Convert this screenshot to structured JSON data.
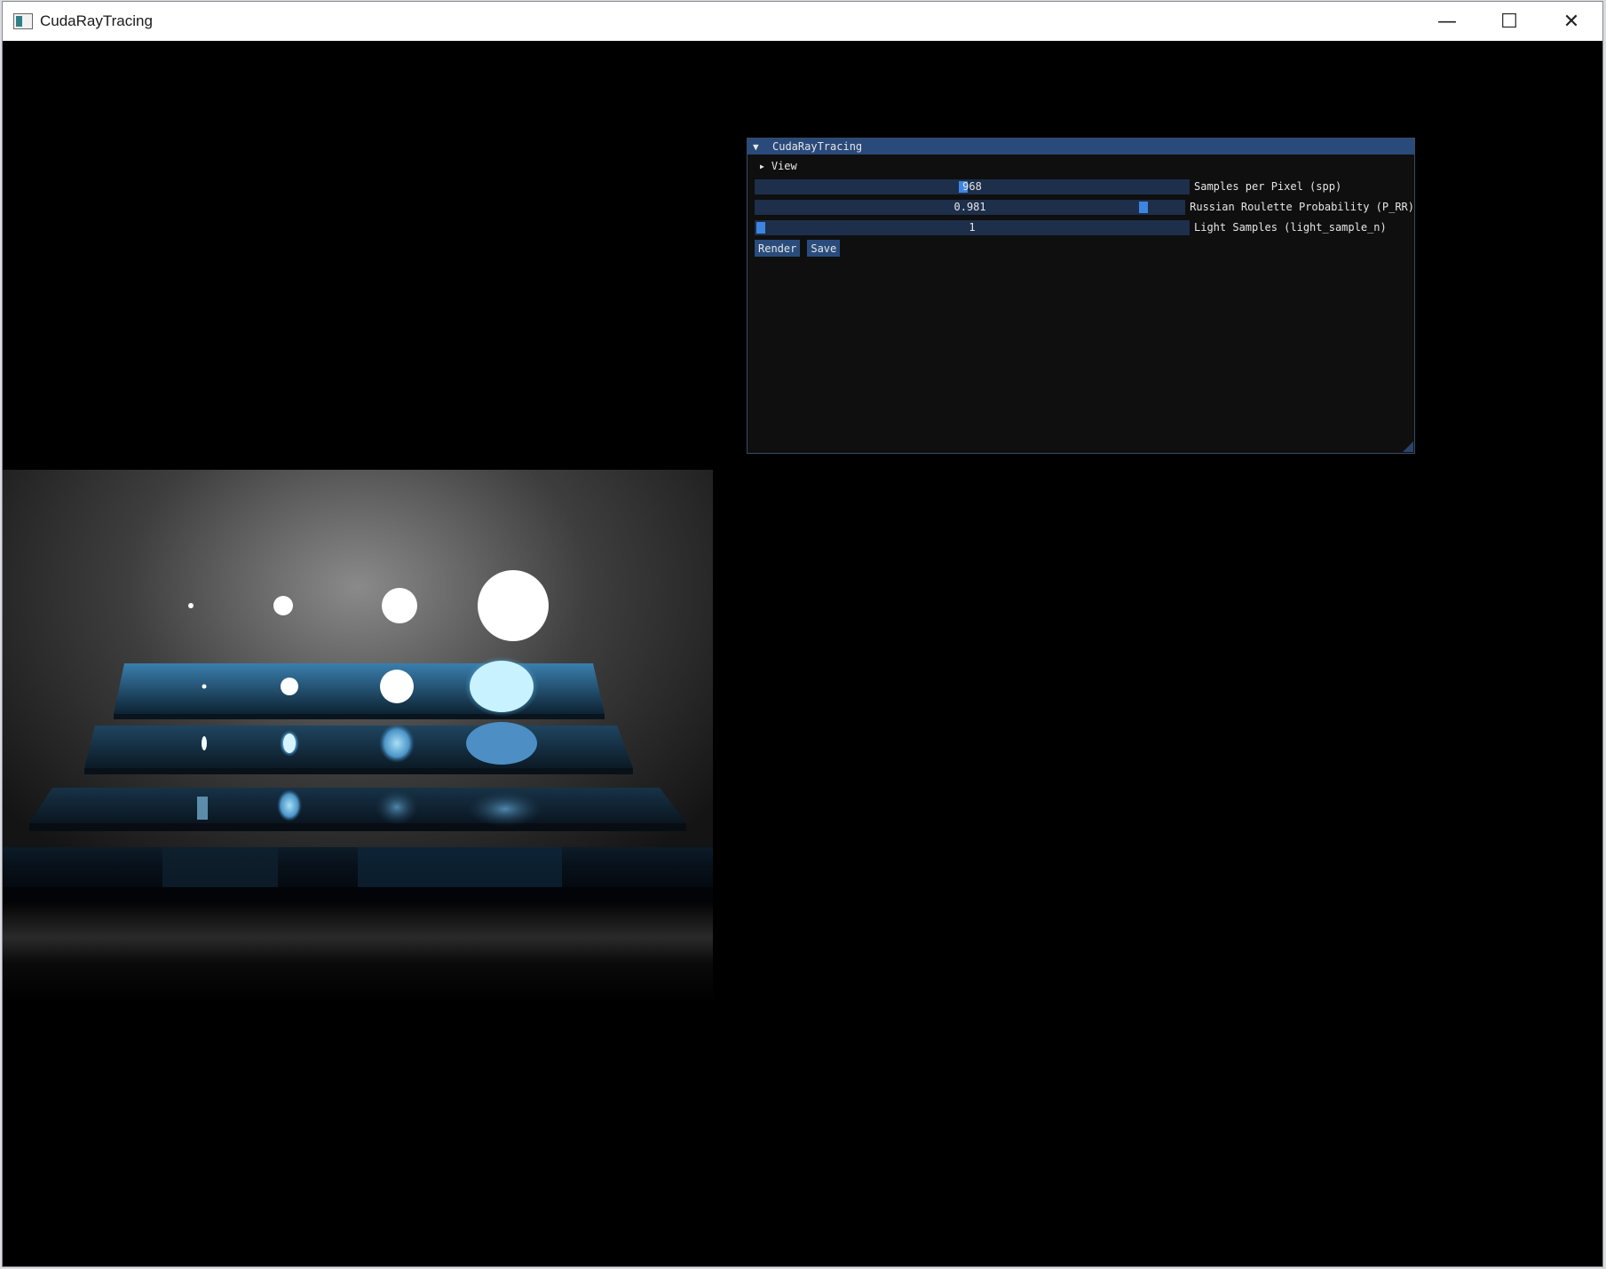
{
  "window": {
    "title": "CudaRayTracing",
    "controls": {
      "minimize": "—",
      "maximize": "☐",
      "close": "✕"
    }
  },
  "panel": {
    "title": "CudaRayTracing",
    "view_label": "View",
    "sliders": [
      {
        "value": "968",
        "label": "Samples per Pixel (spp)",
        "fraction": 0.47
      },
      {
        "value": "0.981",
        "label": "Russian Roulette Probability (P_RR)",
        "fraction": 0.885
      },
      {
        "value": "1",
        "label": "Light Samples (light_sample_n)",
        "fraction": 0.0
      }
    ],
    "buttons": {
      "render": "Render",
      "save": "Save"
    }
  }
}
